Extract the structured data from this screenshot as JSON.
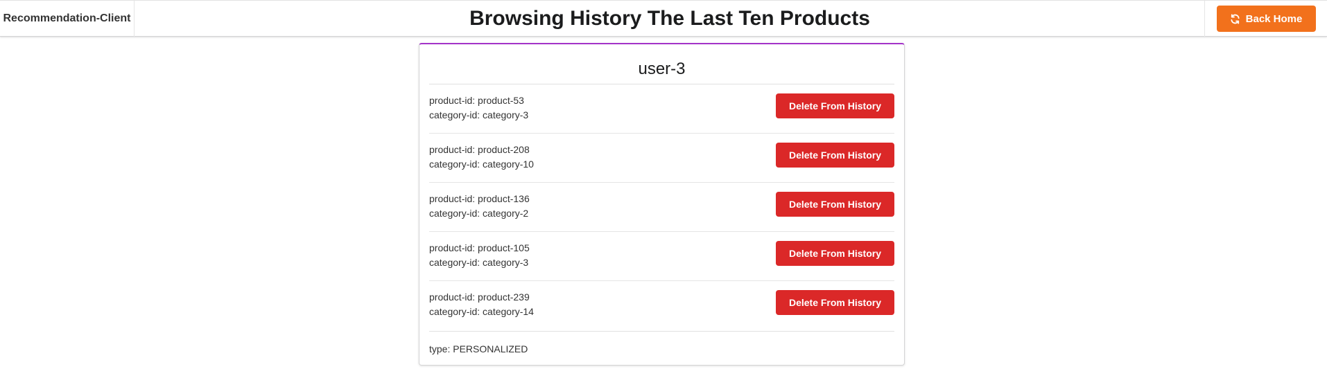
{
  "header": {
    "brand": "Recommendation-Client",
    "title": "Browsing History The Last Ten Products",
    "back_home_label": "Back Home",
    "back_home_icon": "refresh-icon",
    "back_home_color": "#f2711c"
  },
  "card": {
    "user": "user-3",
    "accent_color": "#a333c8",
    "items": [
      {
        "product_label": "product-id: product-53",
        "category_label": "category-id: category-3",
        "button_label": "Delete From History"
      },
      {
        "product_label": "product-id: product-208",
        "category_label": "category-id: category-10",
        "button_label": "Delete From History"
      },
      {
        "product_label": "product-id: product-136",
        "category_label": "category-id: category-2",
        "button_label": "Delete From History"
      },
      {
        "product_label": "product-id: product-105",
        "category_label": "category-id: category-3",
        "button_label": "Delete From History"
      },
      {
        "product_label": "product-id: product-239",
        "category_label": "category-id: category-14",
        "button_label": "Delete From History"
      }
    ],
    "delete_button_color": "#db2828",
    "type_label": "type: PERSONALIZED"
  }
}
